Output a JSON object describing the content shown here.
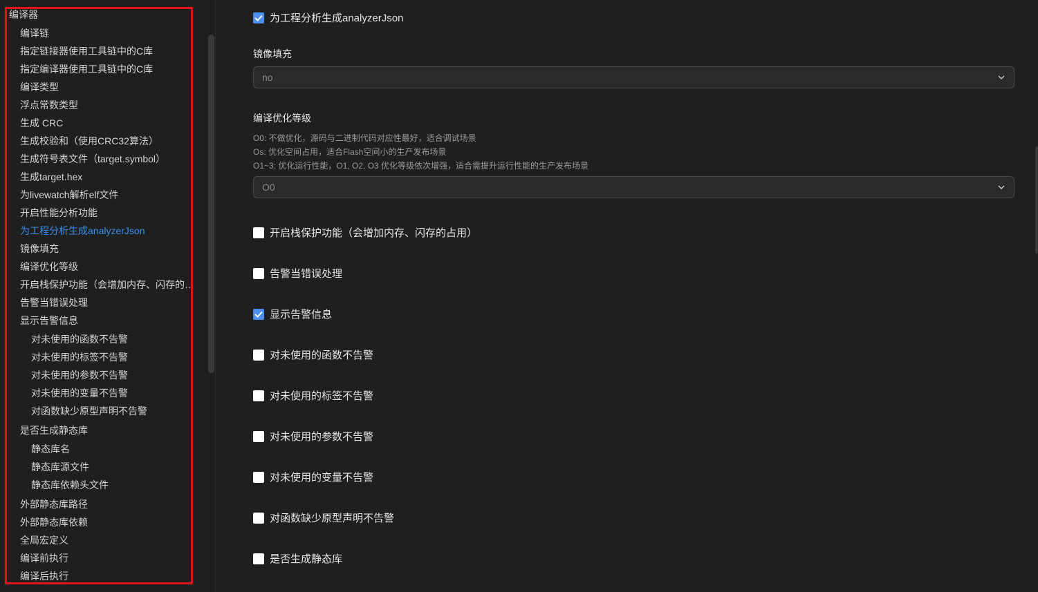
{
  "sidebar": {
    "items": [
      {
        "label": "编译器",
        "level": 0
      },
      {
        "label": "编译链",
        "level": 1
      },
      {
        "label": "指定链接器使用工具链中的C库",
        "level": 1
      },
      {
        "label": "指定编译器使用工具链中的C库",
        "level": 1
      },
      {
        "label": "编译类型",
        "level": 1
      },
      {
        "label": "浮点常数类型",
        "level": 1
      },
      {
        "label": "生成 CRC",
        "level": 1
      },
      {
        "label": "生成校验和（使用CRC32算法）",
        "level": 1
      },
      {
        "label": "生成符号表文件（target.symbol）",
        "level": 1
      },
      {
        "label": "生成target.hex",
        "level": 1
      },
      {
        "label": "为livewatch解析elf文件",
        "level": 1
      },
      {
        "label": "开启性能分析功能",
        "level": 1
      },
      {
        "label": "为工程分析生成analyzerJson",
        "level": 1,
        "active": true
      },
      {
        "label": "镜像填充",
        "level": 1
      },
      {
        "label": "编译优化等级",
        "level": 1
      },
      {
        "label": "开启栈保护功能（会增加内存、闪存的占用）",
        "level": 1
      },
      {
        "label": "告警当错误处理",
        "level": 1
      },
      {
        "label": "显示告警信息",
        "level": 1
      },
      {
        "label": "对未使用的函数不告警",
        "level": 2
      },
      {
        "label": "对未使用的标签不告警",
        "level": 2
      },
      {
        "label": "对未使用的参数不告警",
        "level": 2
      },
      {
        "label": "对未使用的变量不告警",
        "level": 2
      },
      {
        "label": "对函数缺少原型声明不告警",
        "level": 2
      },
      {
        "label": "是否生成静态库",
        "level": 1
      },
      {
        "label": "静态库名",
        "level": 2
      },
      {
        "label": "静态库源文件",
        "level": 2
      },
      {
        "label": "静态库依赖头文件",
        "level": 2
      },
      {
        "label": "外部静态库路径",
        "level": 1
      },
      {
        "label": "外部静态库依赖",
        "level": 1
      },
      {
        "label": "全局宏定义",
        "level": 1
      },
      {
        "label": "编译前执行",
        "level": 1
      },
      {
        "label": "编译后执行",
        "level": 1
      }
    ]
  },
  "main": {
    "analyzer_json": {
      "label": "为工程分析生成analyzerJson",
      "checked": true
    },
    "image_fill": {
      "label": "镜像填充",
      "value": "no"
    },
    "optimize": {
      "label": "编译优化等级",
      "desc": [
        "O0: 不做优化，源码与二进制代码对应性最好，适合调试场景",
        "Os: 优化空间占用，适合Flash空间小的生产发布场景",
        "O1~3: 优化运行性能，O1, O2, O3 优化等级依次增强，适合需提升运行性能的生产发布场景"
      ],
      "value": "O0"
    },
    "checks": [
      {
        "label": "开启栈保护功能（会增加内存、闪存的占用）",
        "checked": false
      },
      {
        "label": "告警当错误处理",
        "checked": false
      },
      {
        "label": "显示告警信息",
        "checked": true
      },
      {
        "label": "对未使用的函数不告警",
        "checked": false
      },
      {
        "label": "对未使用的标签不告警",
        "checked": false
      },
      {
        "label": "对未使用的参数不告警",
        "checked": false
      },
      {
        "label": "对未使用的变量不告警",
        "checked": false
      },
      {
        "label": "对函数缺少原型声明不告警",
        "checked": false
      },
      {
        "label": "是否生成静态库",
        "checked": false
      }
    ]
  },
  "colors": {
    "accent": "#3b8eea",
    "checkbox_checked": "#4a8ff0",
    "highlight_frame": "#e0161b"
  }
}
